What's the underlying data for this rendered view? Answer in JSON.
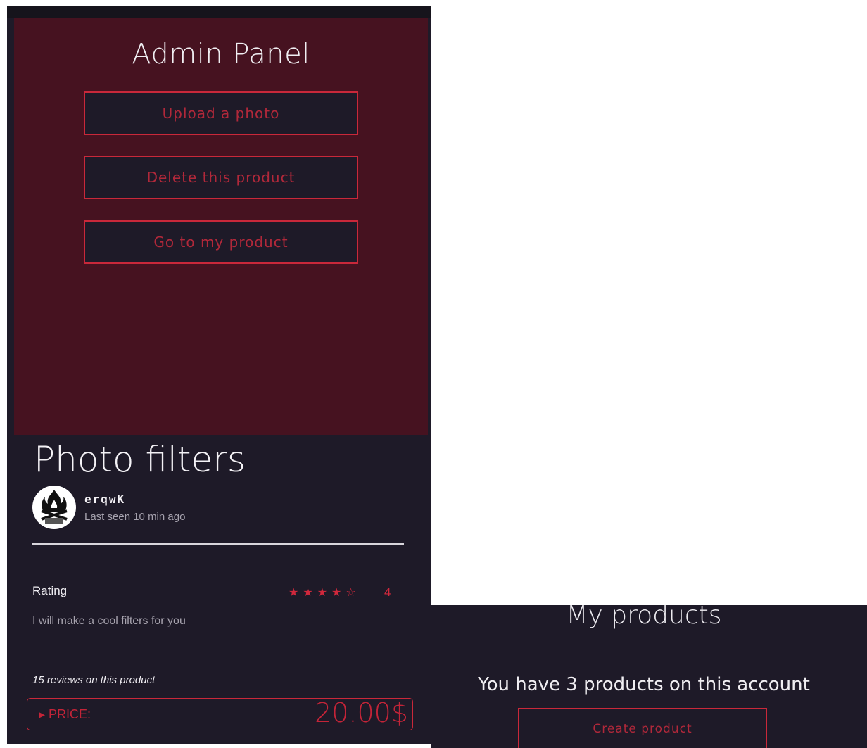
{
  "admin_panel": {
    "title": "Admin Panel",
    "buttons": {
      "upload": "Upload a photo",
      "delete": "Delete this product",
      "go_to": "Go to my product"
    }
  },
  "product": {
    "title": "Photo filters",
    "seller": {
      "username": "erqwK",
      "last_seen": "Last seen 10 min ago"
    },
    "rating": {
      "label": "Rating",
      "stars_display": "★★★★☆",
      "value": "4"
    },
    "description": "I will make a cool filters for you",
    "reviews": "15 reviews on this product",
    "price": {
      "label": "▸ PRICE:",
      "value": "20.00$"
    }
  },
  "my_products": {
    "title": "My products",
    "count_text": "You have 3 products on this account",
    "create_button": "Create product"
  },
  "colors": {
    "accent": "#c9283a",
    "panel_bg": "#1e1a28",
    "admin_bg": "#461220"
  }
}
